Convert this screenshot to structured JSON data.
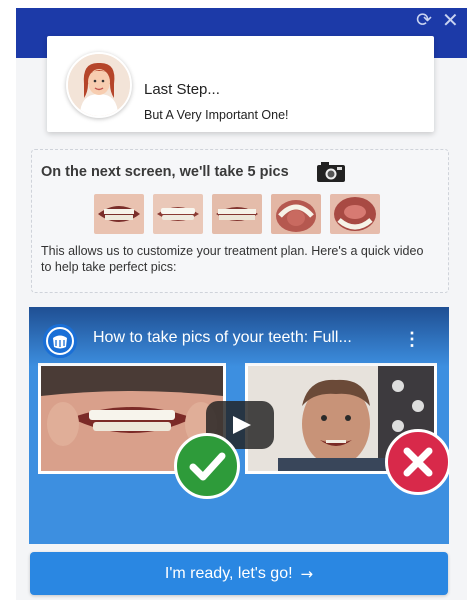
{
  "window": {
    "refresh_icon": "refresh-icon",
    "close_icon": "close-icon",
    "accent": "#1c3aa8"
  },
  "step_card": {
    "title": "Last Step...",
    "subtitle": "But A Very Important One!"
  },
  "info": {
    "heading": "On the next screen, we'll take 5 pics",
    "description": "This allows us to customize your treatment plan. Here's a quick video to help take perfect pics:",
    "photo_count": 5
  },
  "video": {
    "title": "How to take pics of your teeth: Full...",
    "menu_glyph": "⋮",
    "background": "#3d8fe0"
  },
  "cta": {
    "label": "I'm ready, let's go!",
    "arrow": "→",
    "color": "#2a87e2"
  }
}
